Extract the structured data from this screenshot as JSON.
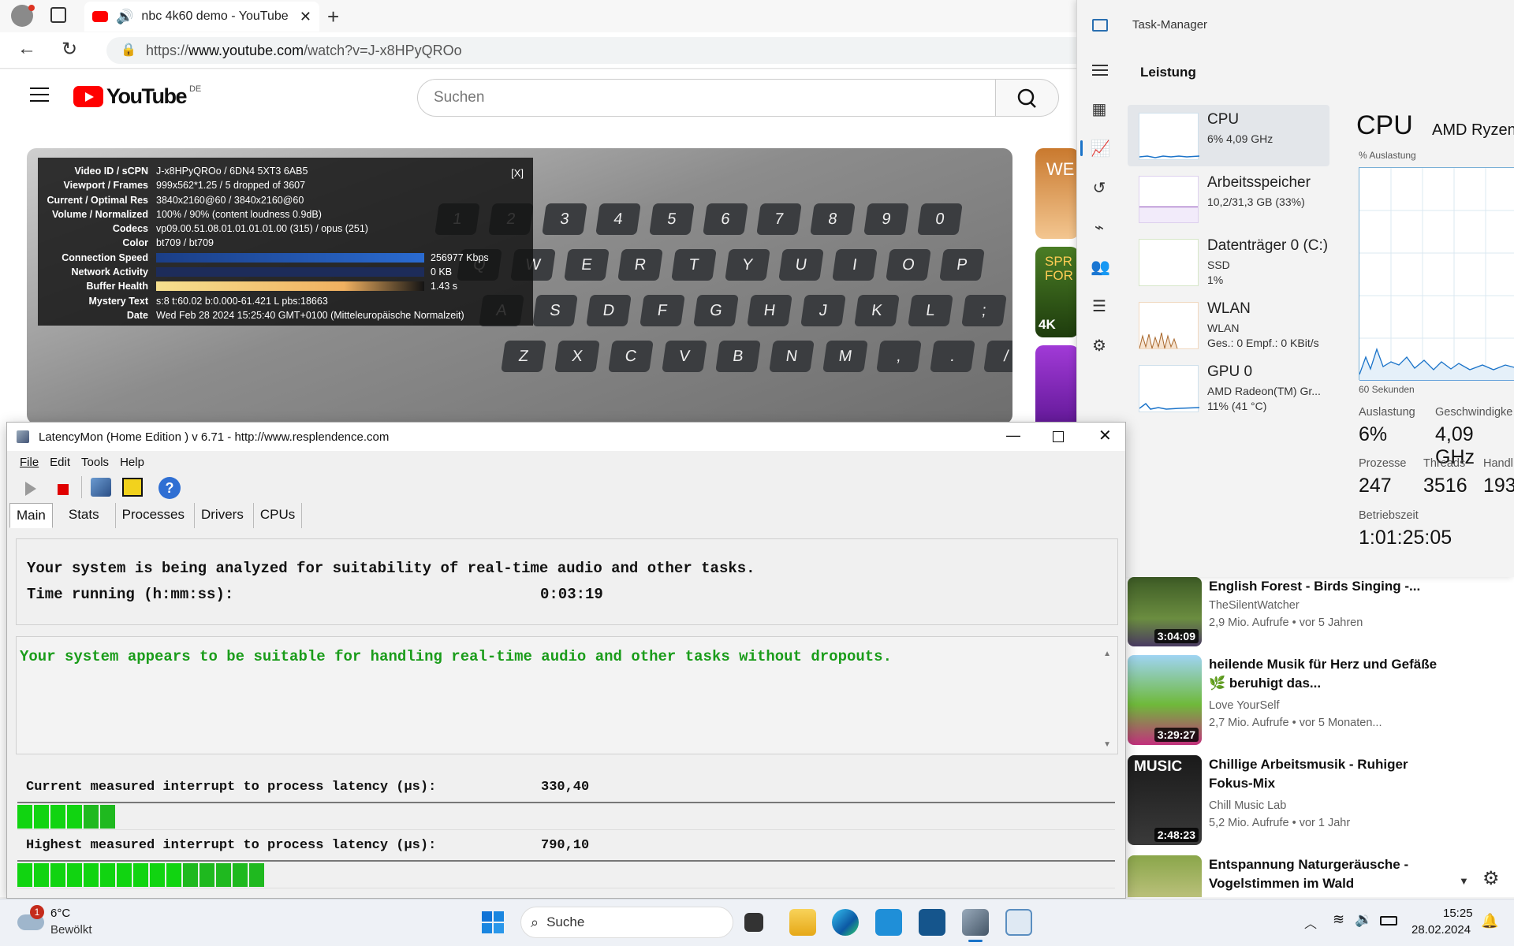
{
  "browser": {
    "tab_title": "nbc 4k60 demo - YouTube",
    "url_prefix": "https://",
    "url_domain": "www.youtube.com",
    "url_path": "/watch?v=J-x8HPyQROo"
  },
  "youtube": {
    "logo": "YouTube",
    "region": "DE",
    "search_placeholder": "Suchen",
    "stats": [
      {
        "k": "Video ID / sCPN",
        "v": "J-x8HPyQROo  /  6DN4  5XT3  6AB5"
      },
      {
        "k": "Viewport / Frames",
        "v": "999x562*1.25 / 5 dropped of 3607"
      },
      {
        "k": "Current / Optimal Res",
        "v": "3840x2160@60 / 3840x2160@60"
      },
      {
        "k": "Volume / Normalized",
        "v": "100% / 90% (content loudness 0.9dB)"
      },
      {
        "k": "Codecs",
        "v": "vp09.00.51.08.01.01.01.01.00 (315) / opus (251)"
      },
      {
        "k": "Color",
        "v": "bt709 / bt709"
      },
      {
        "k": "Connection Speed",
        "v": "256977 Kbps"
      },
      {
        "k": "Network Activity",
        "v": "0 KB"
      },
      {
        "k": "Buffer Health",
        "v": "1.43 s"
      },
      {
        "k": "Mystery Text",
        "v": "s:8 t:60.02 b:0.000-61.421 L pbs:18663"
      },
      {
        "k": "Date",
        "v": "Wed Feb 28 2024 15:25:40 GMT+0100 (Mitteleuropäische Normalzeit)"
      }
    ],
    "stats_close": "[X]",
    "rec_badges": [
      "WE",
      "SPR FOR",
      "4K"
    ],
    "sidebar": [
      {
        "title": "English Forest - Birds Singing -...",
        "channel": "TheSilentWatcher",
        "meta": "2,9 Mio. Aufrufe • vor 5 Jahren",
        "duration": "3:04:09"
      },
      {
        "title": "heilende Musik für Herz und Gefäße 🌿 beruhigt das...",
        "channel": "Love YourSelf",
        "meta": "2,7 Mio. Aufrufe • vor 5 Monaten...",
        "duration": "3:29:27"
      },
      {
        "title": "Chillige Arbeitsmusik - Ruhiger Fokus-Mix",
        "channel": "Chill Music Lab",
        "meta": "5,2 Mio. Aufrufe • vor 1 Jahr",
        "duration": "2:48:23",
        "thumb_text": "MUSIC"
      },
      {
        "title": "Entspannung Naturgeräusche - Vogelstimmen im Wald",
        "channel": "",
        "meta": "",
        "duration": ""
      }
    ]
  },
  "taskmanager": {
    "title": "Task-Manager",
    "section": "Leistung",
    "items": [
      {
        "name": "CPU",
        "sub1": "6% 4,09 GHz",
        "sub2": ""
      },
      {
        "name": "Arbeitsspeicher",
        "sub1": "10,2/31,3 GB (33%)",
        "sub2": ""
      },
      {
        "name": "Datenträger 0 (C:)",
        "sub1": "SSD",
        "sub2": "1%"
      },
      {
        "name": "WLAN",
        "sub1": "WLAN",
        "sub2": "Ges.: 0 Empf.: 0 KBit/s"
      },
      {
        "name": "GPU 0",
        "sub1": "AMD Radeon(TM) Gr...",
        "sub2": "11% (41 °C)"
      }
    ],
    "header": "CPU",
    "cpu_model": "AMD Ryzen",
    "graph_label": "% Auslastung",
    "graph_time": "60 Sekunden",
    "stats": {
      "auslastung_k": "Auslastung",
      "auslastung_v": "6%",
      "speed_k": "Geschwindigke",
      "speed_v": "4,09 GHz",
      "proc_k": "Prozesse",
      "proc_v": "247",
      "threads_k": "Threads",
      "threads_v": "3516",
      "handles_k": "Handl",
      "handles_v": "193",
      "uptime_k": "Betriebszeit",
      "uptime_v": "1:01:25:05"
    }
  },
  "latencymon": {
    "title": "LatencyMon  (Home Edition )  v 6.71 - http://www.resplendence.com",
    "menu": [
      "File",
      "Edit",
      "Tools",
      "Help"
    ],
    "tabs": [
      "Main",
      "Stats",
      "Processes",
      "Drivers",
      "CPUs"
    ],
    "analyzing": "Your system is being analyzed for suitability of real-time audio and other tasks.",
    "time_label": "Time running (h:mm:ss):",
    "time_value": "0:03:19",
    "verdict": "Your system appears to be suitable for handling real-time audio and other tasks without dropouts.",
    "current_label": "Current measured interrupt to process latency (µs):",
    "current_value": "330,40",
    "current_level": 0.09,
    "highest_label": "Highest measured interrupt to process latency (µs):",
    "highest_value": "790,10",
    "highest_level": 0.22
  },
  "taskbar": {
    "weather_temp": "6°C",
    "weather_desc": "Bewölkt",
    "weather_badge": "1",
    "search": "Suche",
    "time": "15:25",
    "date": "28.02.2024"
  },
  "colors": {
    "youtube_red": "#ff0000",
    "verdict_green": "#1a9c1a",
    "latency_green": "#11d411",
    "tm_accent": "#1a73c9"
  }
}
